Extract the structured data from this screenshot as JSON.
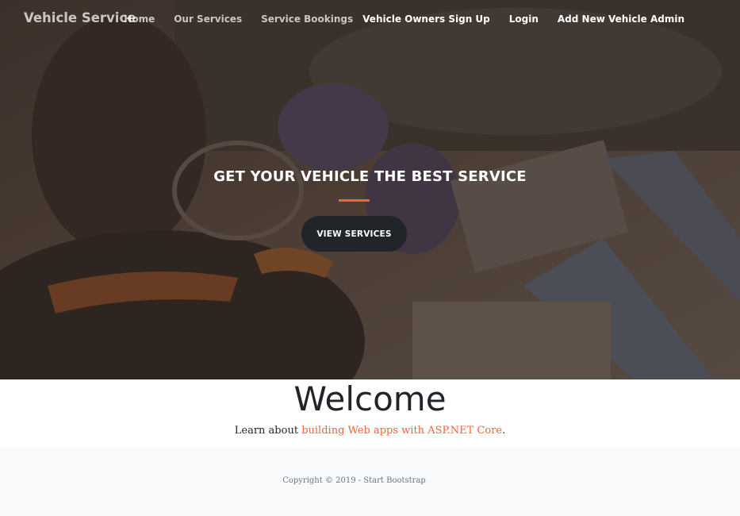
{
  "nav": {
    "brand": "Vehicle Service",
    "links": [
      "Home",
      "Our Services",
      "Service Bookings",
      "Vehicle Owners Sign Up",
      "Login",
      "Add New Vehicle Admin"
    ]
  },
  "hero": {
    "headline": "GET YOUR VEHICLE THE BEST SERVICE",
    "button": "VIEW SERVICES"
  },
  "welcome": {
    "title": "Welcome",
    "text_prefix": "Learn about ",
    "link_text": "building Web apps with ASP.NET Core",
    "text_suffix": "."
  },
  "footer": {
    "copyright": "Copyright © 2019 - Start Bootstrap"
  },
  "colors": {
    "accent": "#f4623a",
    "button_bg": "#212529",
    "footer_bg": "#f8f9fa"
  }
}
